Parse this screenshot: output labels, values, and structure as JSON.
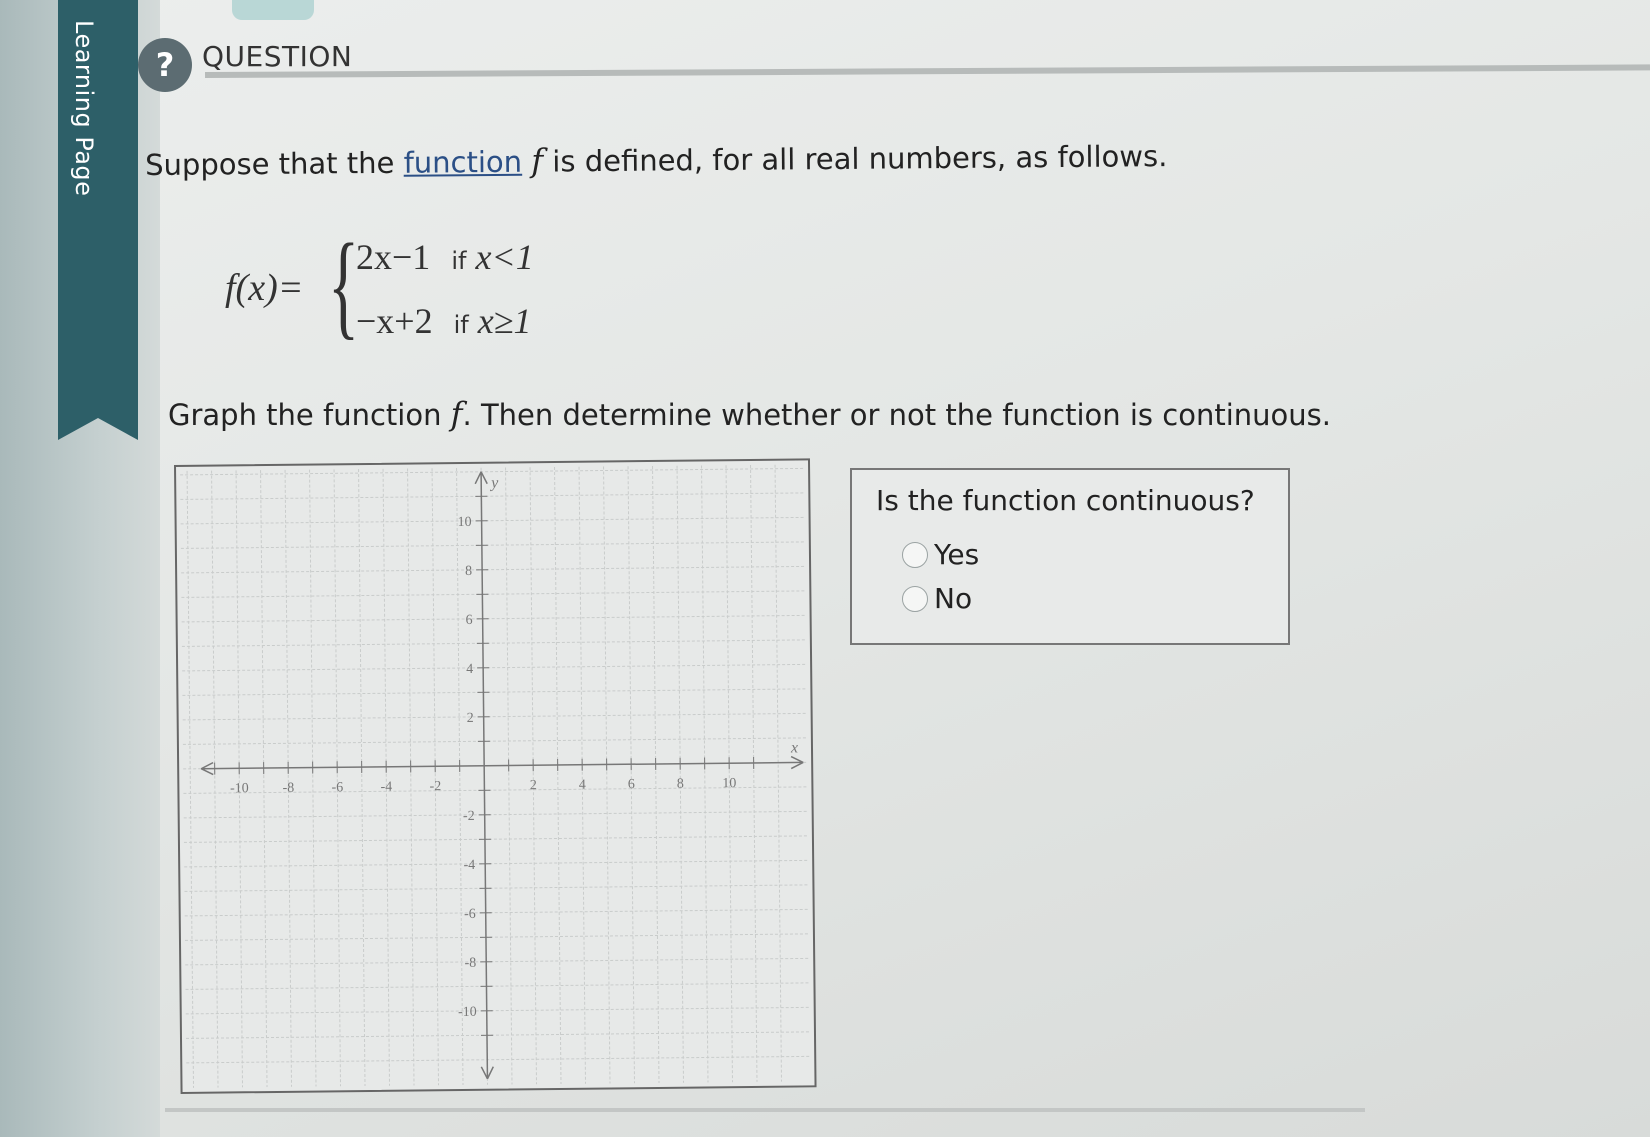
{
  "sidebar": {
    "tab_label": "Learning Page"
  },
  "header": {
    "help_icon": "?",
    "title": "QUESTION"
  },
  "prompt": {
    "before": "Suppose that the ",
    "link": "function",
    "var": "f",
    "after": " is defined, for all real numbers, as follows."
  },
  "definition": {
    "lhs": "f(x)=",
    "pieces": [
      {
        "expr": "2x−1",
        "cond": "if",
        "cond_expr": "x<1"
      },
      {
        "expr": "−x+2",
        "cond": "if",
        "cond_expr": "x≥1"
      }
    ]
  },
  "instruction": {
    "before": "Graph the function ",
    "var": "f",
    "after": ". Then determine whether or not the function is continuous."
  },
  "graph": {
    "x_axis_label": "x",
    "y_axis_label": "y",
    "x_range": [
      -12,
      12
    ],
    "y_range": [
      -12,
      12
    ],
    "x_ticks": [
      -10,
      -8,
      -6,
      -4,
      -2,
      2,
      4,
      6,
      8,
      10
    ],
    "y_ticks": [
      10,
      8,
      6,
      4,
      2,
      -2,
      -4,
      -6,
      -8,
      -10
    ],
    "grid": true
  },
  "continuity": {
    "question": "Is the function continuous?",
    "options": [
      "Yes",
      "No"
    ],
    "selected": null
  }
}
